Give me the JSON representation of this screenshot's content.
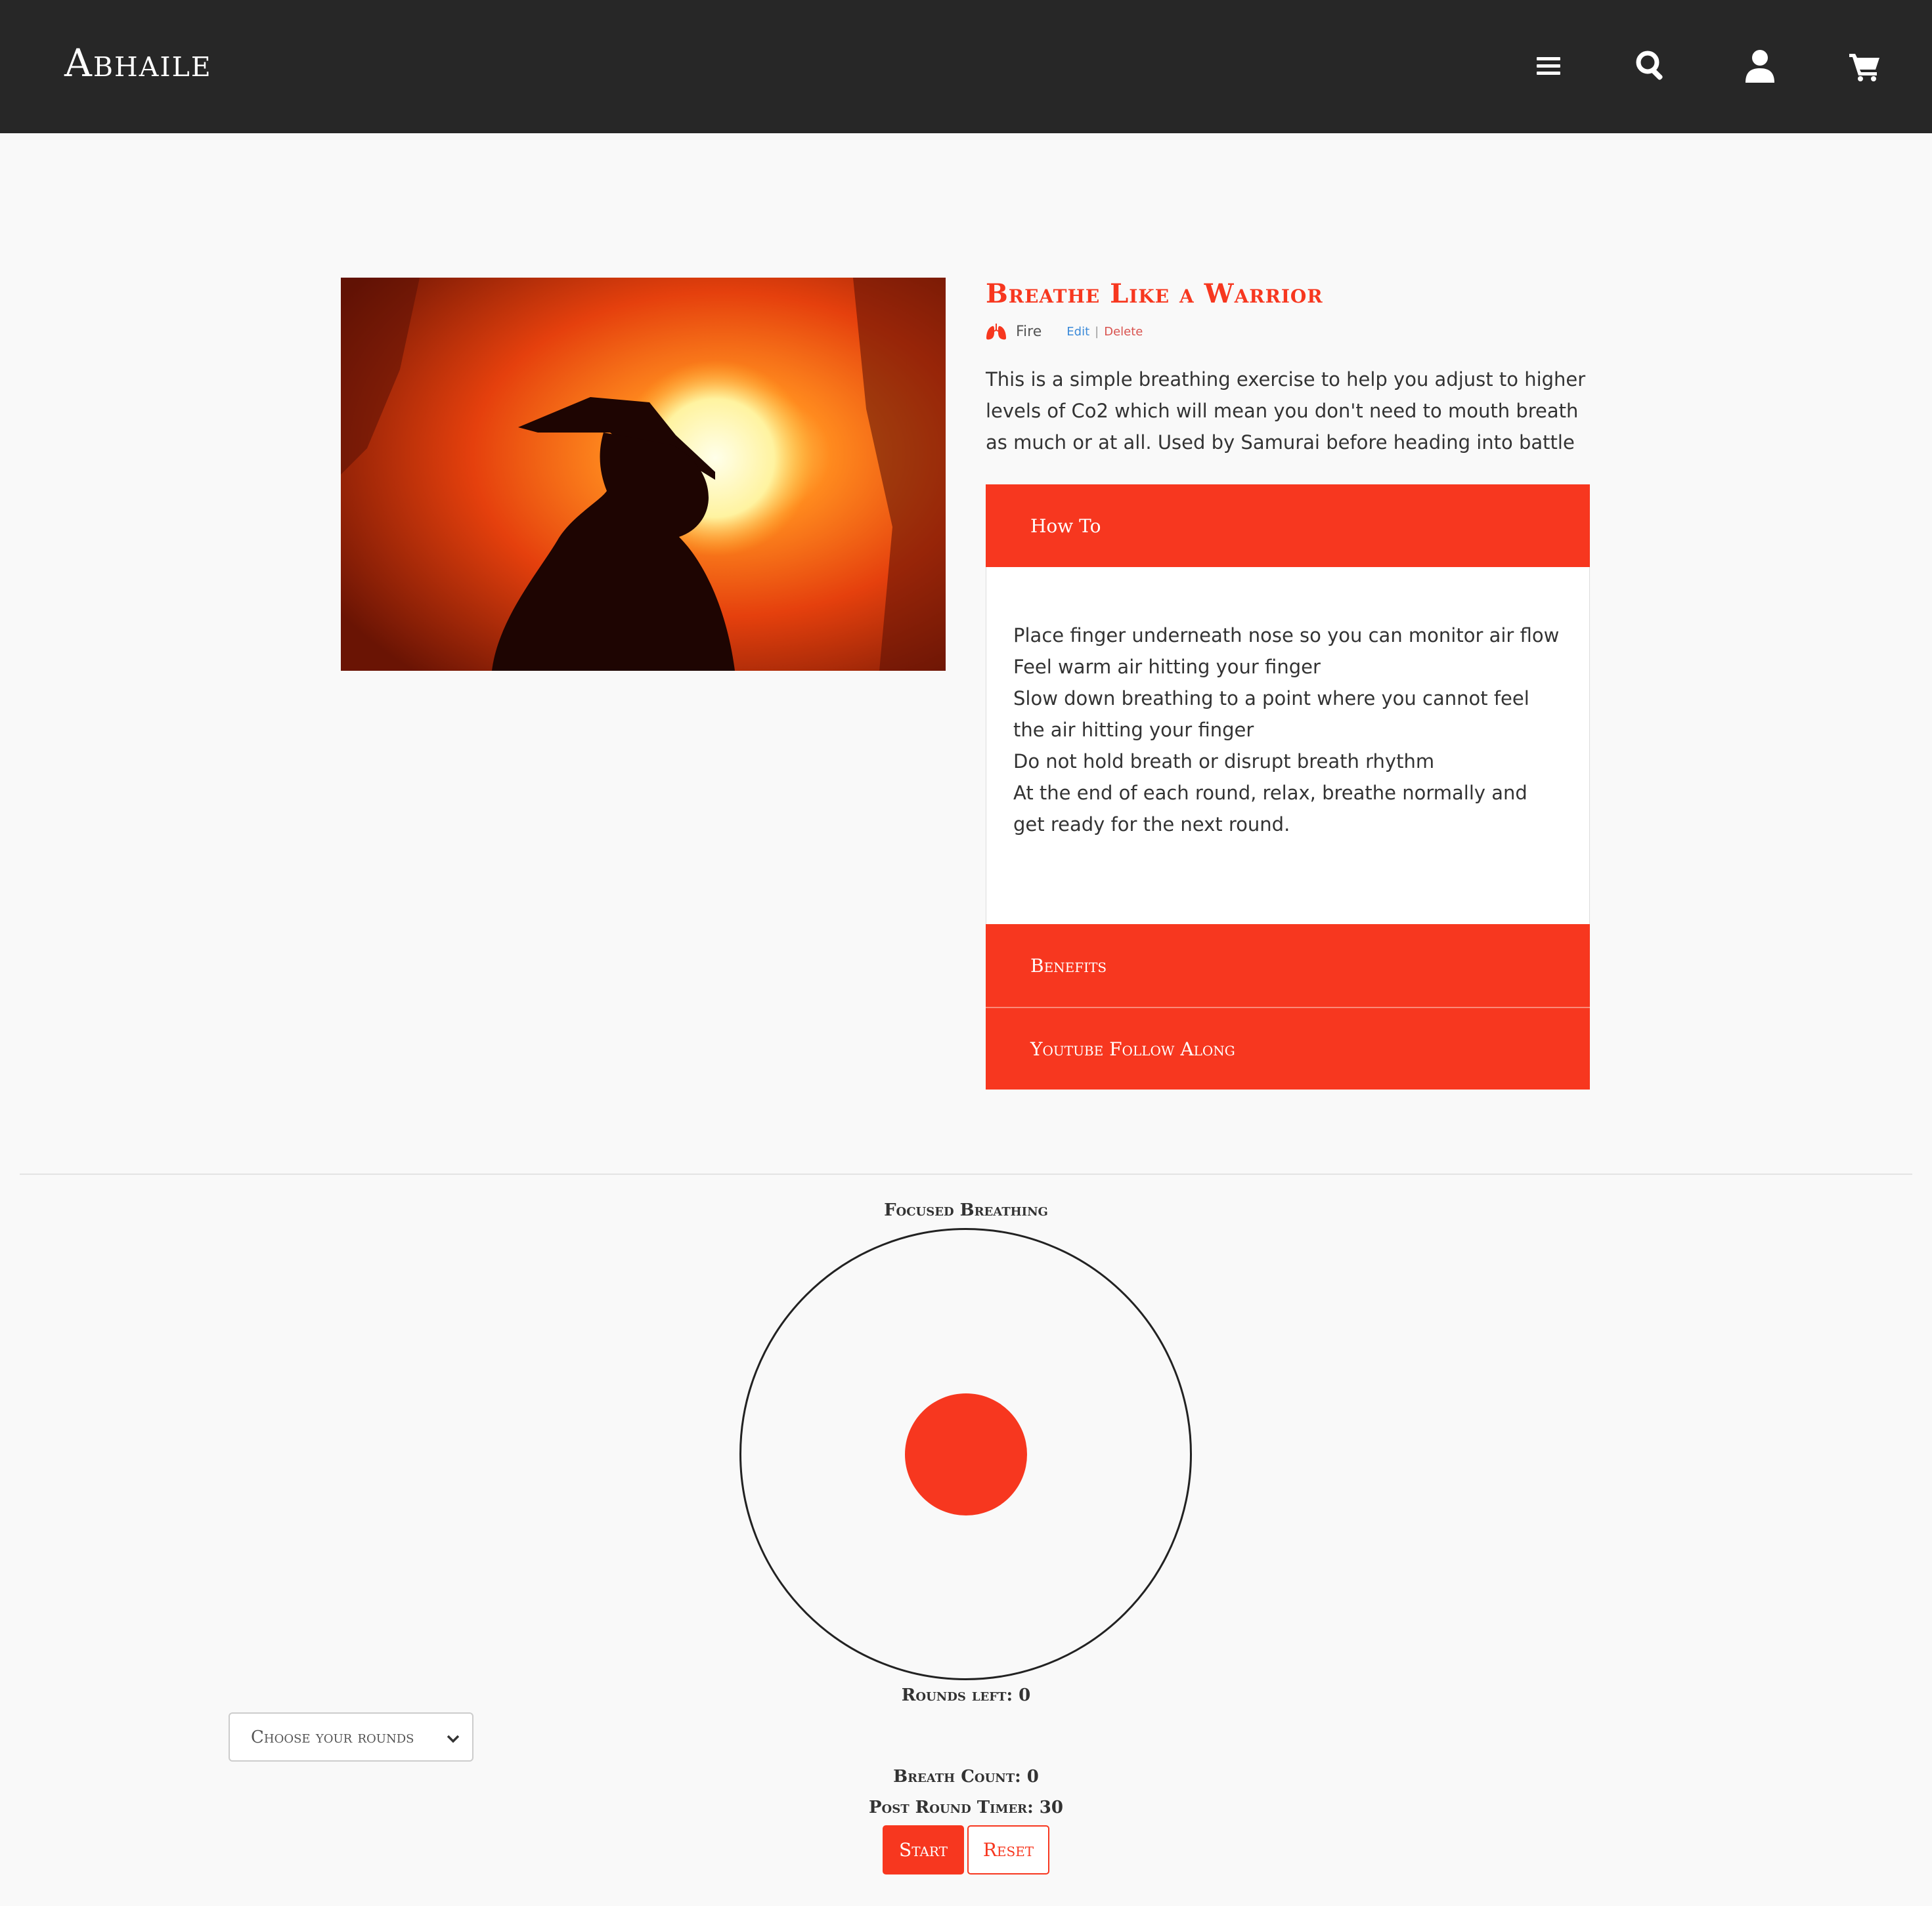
{
  "nav": {
    "brand": "Abhaile",
    "icons": [
      "menu-icon",
      "search-icon",
      "user-icon",
      "cart-icon"
    ]
  },
  "exercise": {
    "title": "Breathe Like a Warrior",
    "category": "Fire",
    "category_icon": "lungs-icon",
    "edit_label": "Edit",
    "separator": "|",
    "delete_label": "Delete",
    "description": "This is a simple breathing exercise to help you adjust to higher levels of Co2 which will mean you don't need to mouth breath as much or at all. Used by Samurai before heading into battle"
  },
  "accordion": {
    "how_to_label": "How To",
    "how_to_lines": [
      "Place finger underneath nose so you can monitor air flow",
      "Feel warm air hitting your finger",
      "Slow down breathing to a point where you cannot feel the air hitting your finger",
      "Do not hold breath or disrupt breath rhythm",
      "At the end of each round, relax, breathe normally and get ready for the next round."
    ],
    "benefits_label": "Benefits",
    "youtube_label": "Youtube Follow Along"
  },
  "breathing": {
    "heading": "Focused Breathing",
    "rounds_left": "Rounds left: 0",
    "breath_count": "Breath Count: 0",
    "post_round_timer": "Post Round Timer: 30",
    "rounds_select_value": "Choose your rounds",
    "start_label": "Start",
    "reset_label": "Reset"
  },
  "colors": {
    "accent": "#f7371f",
    "navbar": "#272727",
    "background": "#f9f9f9"
  }
}
